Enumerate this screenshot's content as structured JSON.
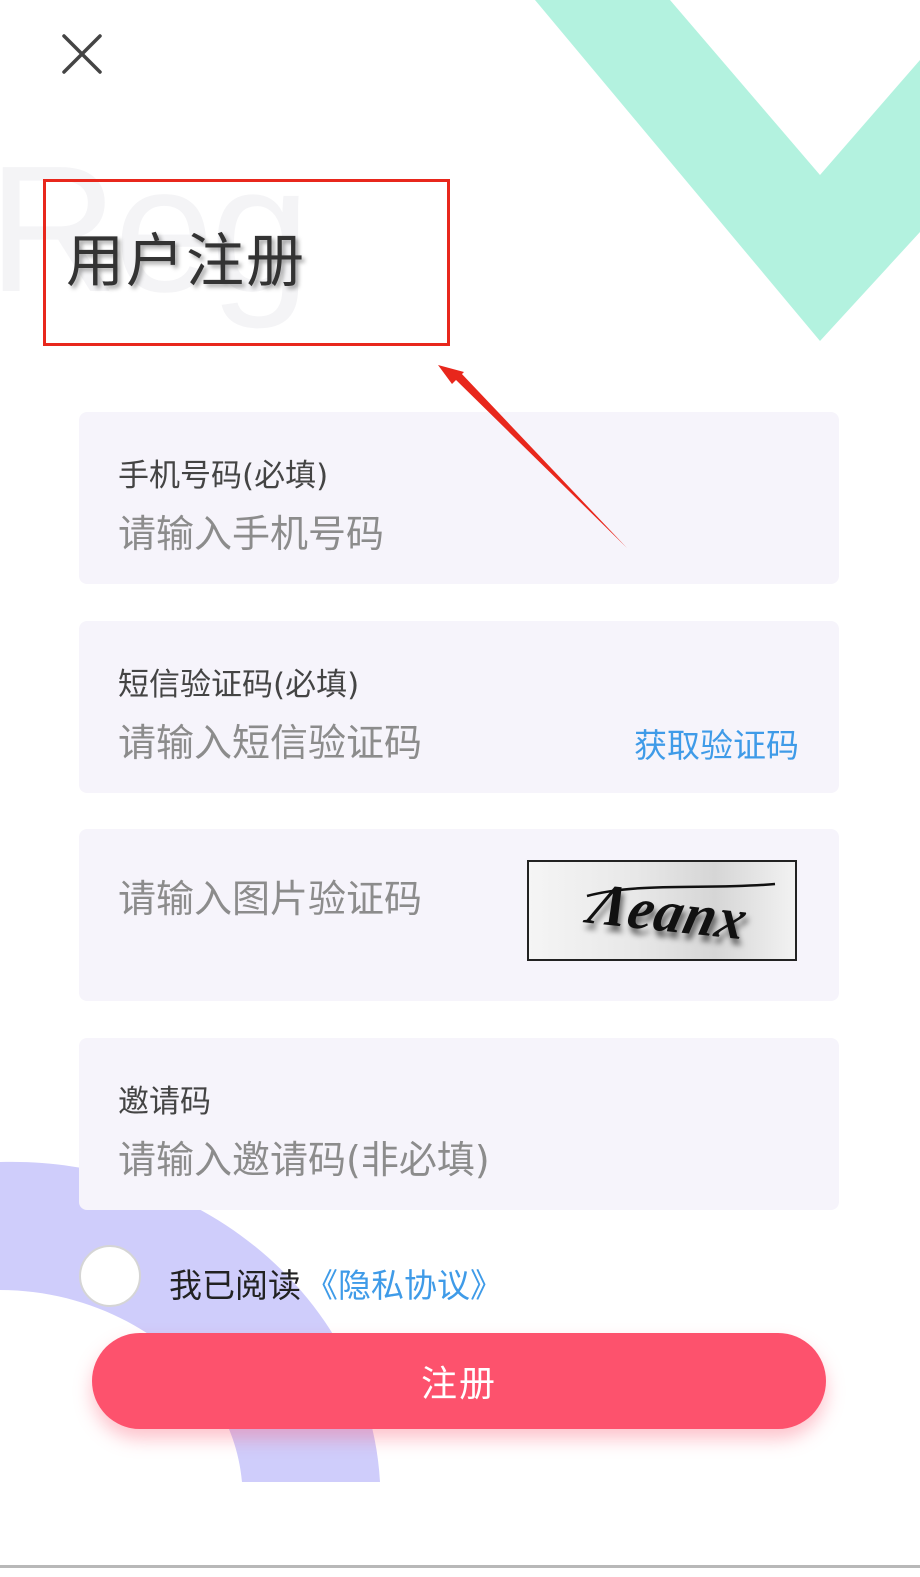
{
  "header": {
    "close_icon": "close-icon",
    "watermark": "Reg",
    "title": "用户注册"
  },
  "form": {
    "phone": {
      "label": "手机号码(必填)",
      "placeholder": "请输入手机号码"
    },
    "sms_code": {
      "label": "短信验证码(必填)",
      "placeholder": "请输入短信验证码",
      "get_code_label": "获取验证码"
    },
    "image_code": {
      "placeholder": "请输入图片验证码",
      "captcha_text": "Λeanx"
    },
    "invite_code": {
      "label": "邀请码",
      "placeholder": "请输入邀请码(非必填)"
    }
  },
  "agreement": {
    "checked": false,
    "text": "我已阅读",
    "link_label": "《隐私协议》"
  },
  "submit": {
    "label": "注册"
  },
  "colors": {
    "accent": "#fd526d",
    "link": "#3f9be8",
    "field_bg": "#f6f4fb",
    "deco_green": "#b3f2df",
    "deco_purple": "#cfcdfb",
    "annotation_red": "#e8271c"
  }
}
